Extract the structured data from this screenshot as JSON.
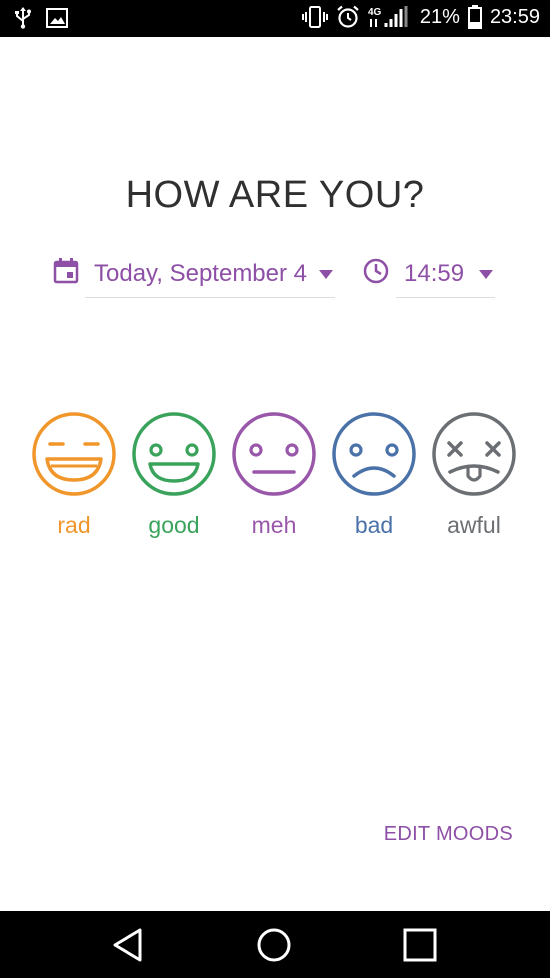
{
  "status_bar": {
    "battery_percent": "21%",
    "time": "23:59",
    "network": "4G",
    "icons": [
      "usb-icon",
      "image-icon",
      "vibrate-icon",
      "alarm-icon",
      "signal-icon",
      "battery-icon"
    ]
  },
  "title": "HOW ARE YOU?",
  "date_picker": {
    "label": "Today, September 4",
    "icon": "calendar-icon"
  },
  "time_picker": {
    "label": "14:59",
    "icon": "clock-icon"
  },
  "moods": [
    {
      "label": "rad",
      "color": "#f0962a"
    },
    {
      "label": "good",
      "color": "#3aa35b"
    },
    {
      "label": "meh",
      "color": "#9957aa"
    },
    {
      "label": "bad",
      "color": "#4a72a8"
    },
    {
      "label": "awful",
      "color": "#6b6f73"
    }
  ],
  "edit_moods_label": "EDIT MOODS",
  "accent_color": "#8e4fa6",
  "nav_bar": {
    "icons": [
      "back-icon",
      "home-icon",
      "recents-icon"
    ]
  }
}
